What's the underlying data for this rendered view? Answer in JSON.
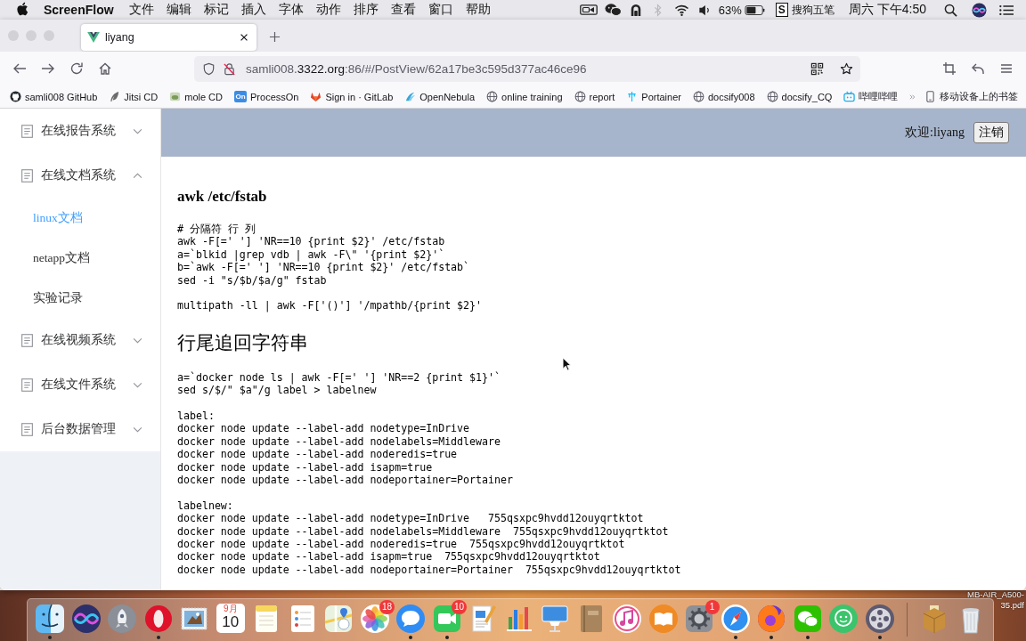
{
  "menu_bar": {
    "app_name": "ScreenFlow",
    "menus": [
      "文件",
      "编辑",
      "标记",
      "插入",
      "字体",
      "动作",
      "排序",
      "查看",
      "窗口",
      "帮助"
    ],
    "bluetooth_enabled": false,
    "battery_percent": "63%",
    "input_method": {
      "logo": "S",
      "name": "搜狗五笔"
    },
    "clock": "周六 下午4:50"
  },
  "browser": {
    "tabs": [
      {
        "title": "liyang",
        "selected": true
      }
    ],
    "address": {
      "before": "samli008.",
      "domain": "3322.org",
      "after": ":86/#/PostView/62a17be3c595d377ac46ce96"
    },
    "bookmarks": [
      {
        "label": "samli008 GitHub"
      },
      {
        "label": "Jitsi CD"
      },
      {
        "label": "mole CD"
      },
      {
        "label": "ProcessOn",
        "logo": "On"
      },
      {
        "label": "Sign in · GitLab"
      },
      {
        "label": "OpenNebula"
      },
      {
        "label": "online training"
      },
      {
        "label": "report"
      },
      {
        "label": "Portainer"
      },
      {
        "label": "docsify008"
      },
      {
        "label": "docsify_CQ"
      },
      {
        "label": "哔哩哔哩"
      }
    ],
    "mobile_bookmarks": "移动设备上的书签"
  },
  "app": {
    "sidebar": {
      "menus": [
        {
          "label": "在线报告系统",
          "expanded": false
        },
        {
          "label": "在线文档系统",
          "expanded": true,
          "children": [
            {
              "label": "linux文档",
              "selected": true
            },
            {
              "label": "netapp文档",
              "selected": false
            },
            {
              "label": "实验记录",
              "selected": false
            }
          ]
        },
        {
          "label": "在线视频系统",
          "expanded": false
        },
        {
          "label": "在线文件系统",
          "expanded": false
        },
        {
          "label": "后台数据管理",
          "expanded": false
        }
      ]
    },
    "header": {
      "welcome": "欢迎:liyang",
      "logout": "注销"
    },
    "article": {
      "blocks": [
        {
          "kind": "h3",
          "text": "awk /etc/fstab"
        },
        {
          "kind": "code",
          "lines": [
            "# 分隔符 行 列",
            "awk -F[=' '] 'NR==10 {print $2}' /etc/fstab",
            "a=`blkid |grep vdb | awk -F\\\" '{print $2}'`",
            "b=`awk -F[=' '] 'NR==10 {print $2}' /etc/fstab`",
            "sed -i \"s/$b/$a/g\" fstab"
          ]
        },
        {
          "kind": "code",
          "lines": [
            "multipath -ll | awk -F['()'] '/mpathb/{print $2}'"
          ]
        },
        {
          "kind": "h2",
          "text": "行尾追回字符串"
        },
        {
          "kind": "code",
          "lines": [
            "a=`docker node ls | awk -F[=' '] 'NR==2 {print $1}'`",
            "sed s/$/\" $a\"/g label > labelnew"
          ]
        },
        {
          "kind": "code",
          "lines": [
            "label:",
            "docker node update --label-add nodetype=InDrive",
            "docker node update --label-add nodelabels=Middleware",
            "docker node update --label-add noderedis=true",
            "docker node update --label-add isapm=true",
            "docker node update --label-add nodeportainer=Portainer"
          ]
        },
        {
          "kind": "code",
          "lines": [
            "labelnew:",
            "docker node update --label-add nodetype=InDrive   755qsxpc9hvdd12ouyqrtktot",
            "docker node update --label-add nodelabels=Middleware  755qsxpc9hvdd12ouyqrtktot",
            "docker node update --label-add noderedis=true  755qsxpc9hvdd12ouyqrtktot",
            "docker node update --label-add isapm=true  755qsxpc9hvdd12ouyqrtktot",
            "docker node update --label-add nodeportainer=Portainer  755qsxpc9hvdd12ouyqrtktot"
          ]
        }
      ]
    }
  },
  "dock": {
    "apps": [
      {
        "running": true
      },
      {
        "running": false
      },
      {
        "running": false
      },
      {
        "running": true
      },
      {
        "running": false
      },
      {
        "running": false,
        "month": "9月",
        "day": "10"
      },
      {
        "running": false
      },
      {
        "running": false
      },
      {
        "running": false
      },
      {
        "running": false,
        "badge": "18"
      },
      {
        "running": true
      },
      {
        "running": true,
        "badge": "10"
      },
      {
        "running": false
      },
      {
        "running": false
      },
      {
        "running": false
      },
      {
        "running": false
      },
      {
        "running": false
      },
      {
        "running": false
      },
      {
        "running": false,
        "badge": "1"
      },
      {
        "running": true
      },
      {
        "running": true
      },
      {
        "running": true
      },
      {
        "running": false
      },
      {
        "running": true
      }
    ]
  },
  "desktop": {
    "file_label_lines": [
      "MB-AIR_A500-",
      "35.pdf"
    ]
  }
}
